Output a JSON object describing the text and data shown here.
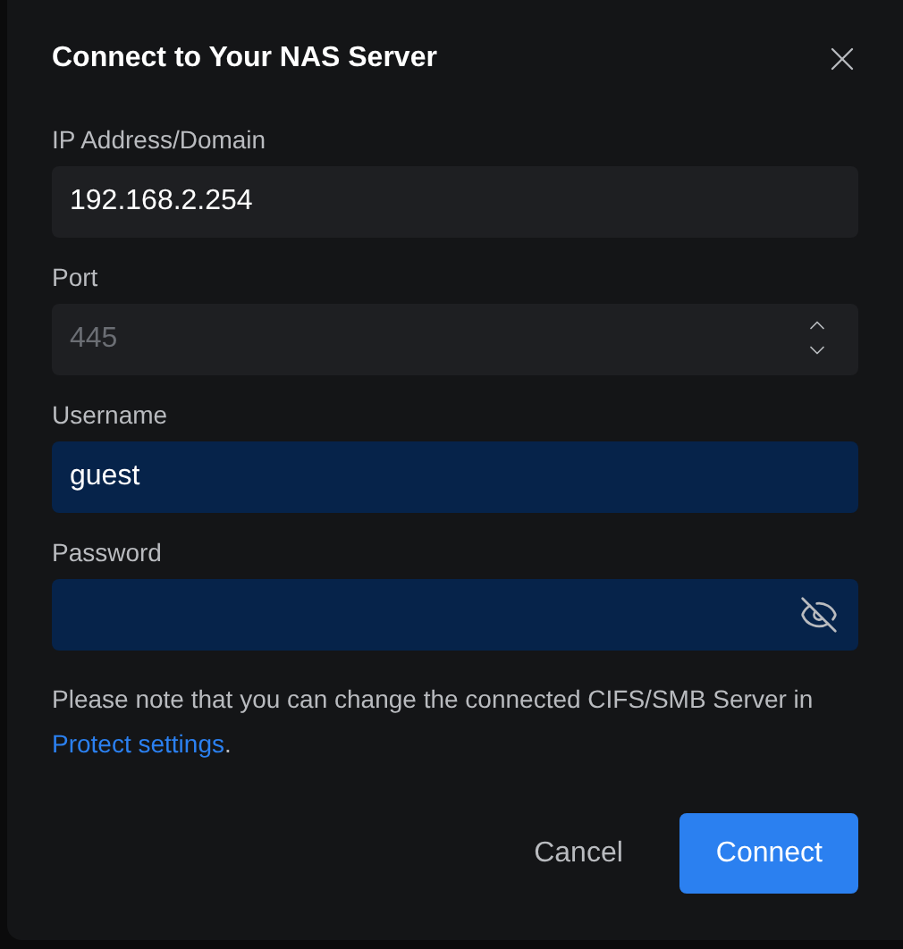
{
  "dialog": {
    "title": "Connect to Your NAS Server"
  },
  "fields": [
    {
      "kind": "text",
      "label": "IP Address/Domain",
      "value": "192.168.2.254",
      "autofilled": false
    },
    {
      "kind": "number",
      "label": "Port",
      "placeholder": "445",
      "autofilled": false
    },
    {
      "kind": "text",
      "label": "Username",
      "value": "guest",
      "autofilled": true
    },
    {
      "kind": "password",
      "label": "Password",
      "autofilled": true
    }
  ],
  "note": {
    "text": "Please note that you can change the connected CIFS/SMB Server in",
    "link": "Protect settings",
    "end": "."
  },
  "buttons": [
    {
      "kind": "secondary",
      "label": "Cancel"
    },
    {
      "kind": "primary",
      "label": "Connect"
    }
  ]
}
